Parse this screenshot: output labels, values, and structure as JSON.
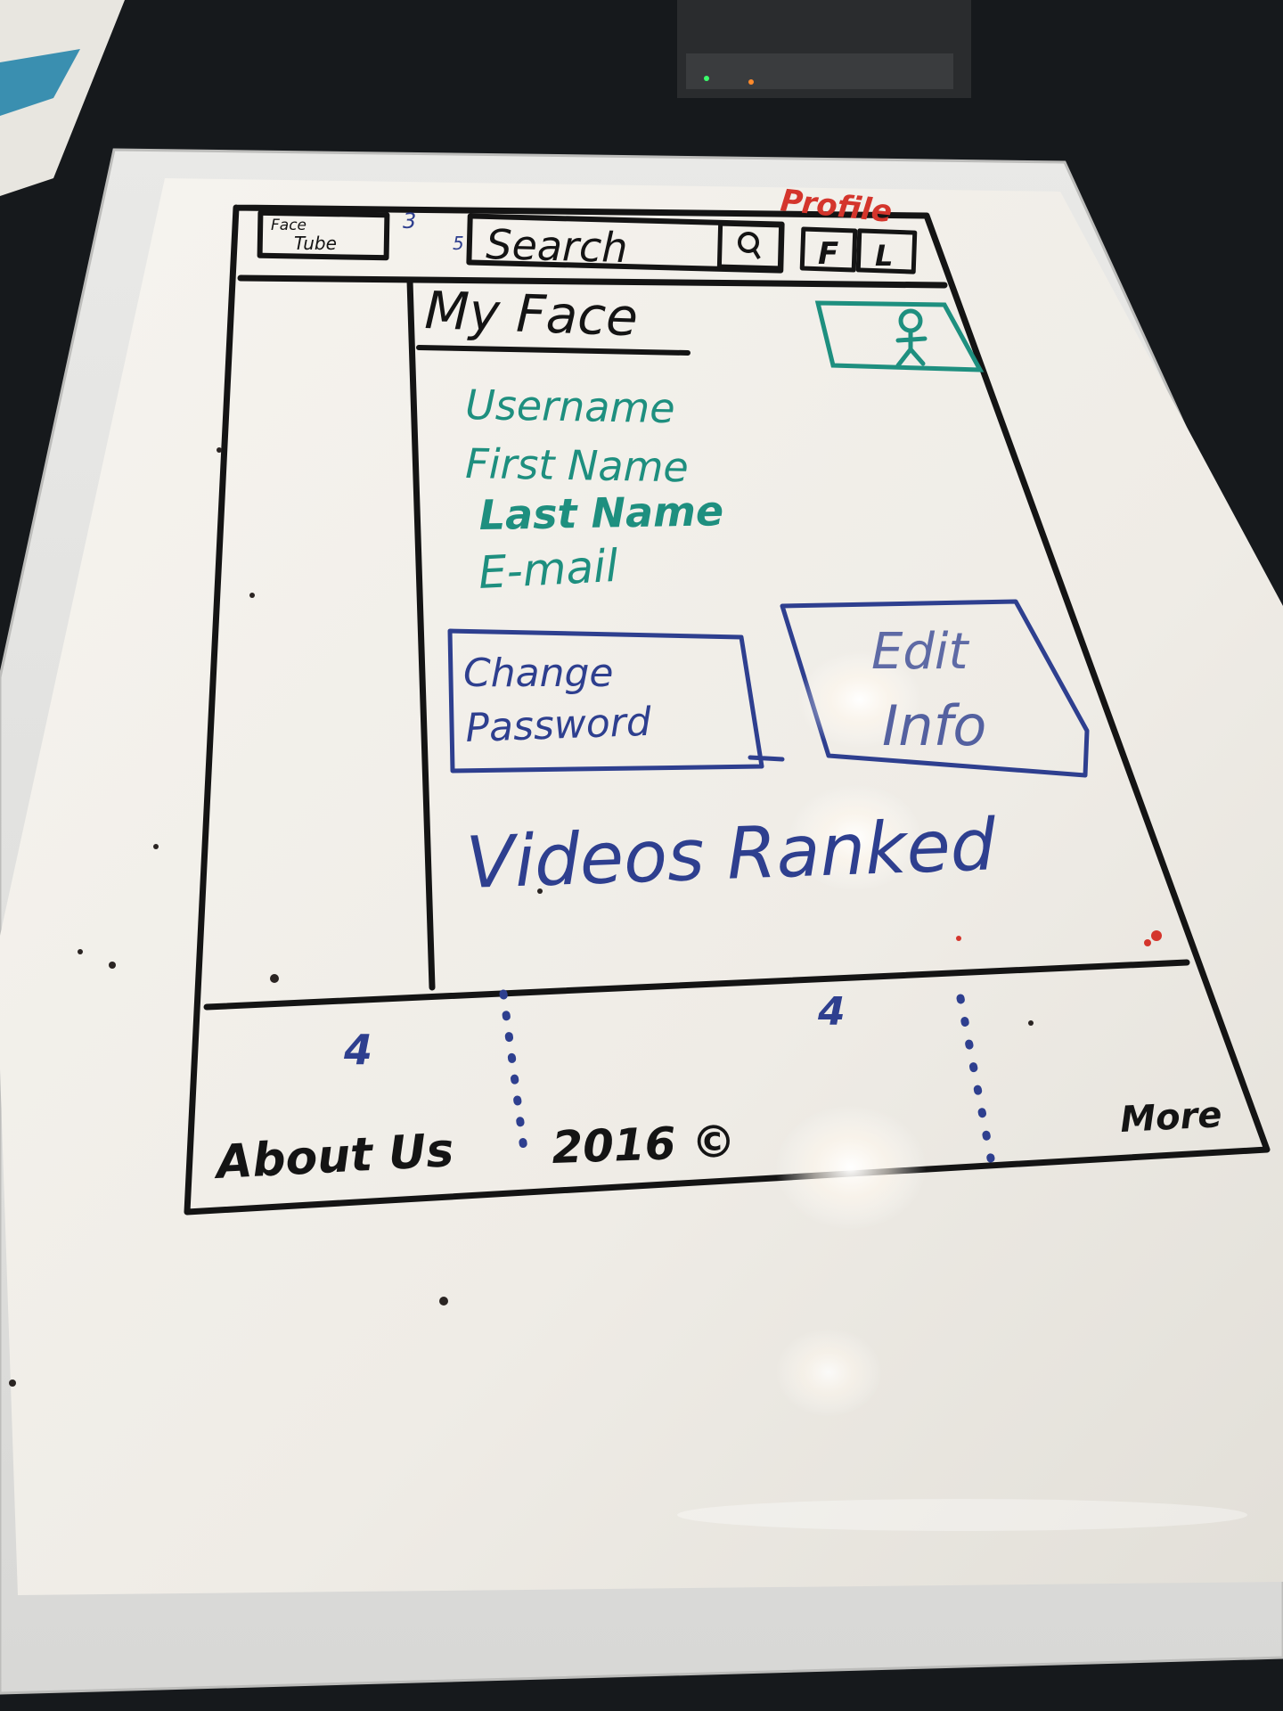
{
  "colors": {
    "black_marker": "#141414",
    "green_marker": "#1e8f7f",
    "blue_marker": "#2e3f8f",
    "red_marker": "#d4352c",
    "board": "#f3f1ec",
    "frame": "#e6e6e4",
    "background": "#16191c"
  },
  "sketch": {
    "page_label": "Profile",
    "header": {
      "logo_line1": "Face",
      "logo_line2": "Tube",
      "logo_note": "3",
      "search_note": "5",
      "search_label": "Search",
      "search_button_icon": "magnifier-icon",
      "facebook_button": "F",
      "linkedin_button": "L"
    },
    "main": {
      "title": "My Face",
      "avatar_icon": "stick-figure-icon",
      "fields": [
        "Username",
        "First Name",
        "Last Name",
        "E-mail"
      ],
      "change_password_line1": "Change",
      "change_password_line2": "Password",
      "edit_info_line1": "Edit",
      "edit_info_line2": "Info",
      "videos_ranked": "Videos Ranked"
    },
    "footer": {
      "note_left": "4",
      "note_right": "4",
      "about_us": "About Us",
      "center_text": "2016 ©",
      "right_text": "More"
    }
  }
}
